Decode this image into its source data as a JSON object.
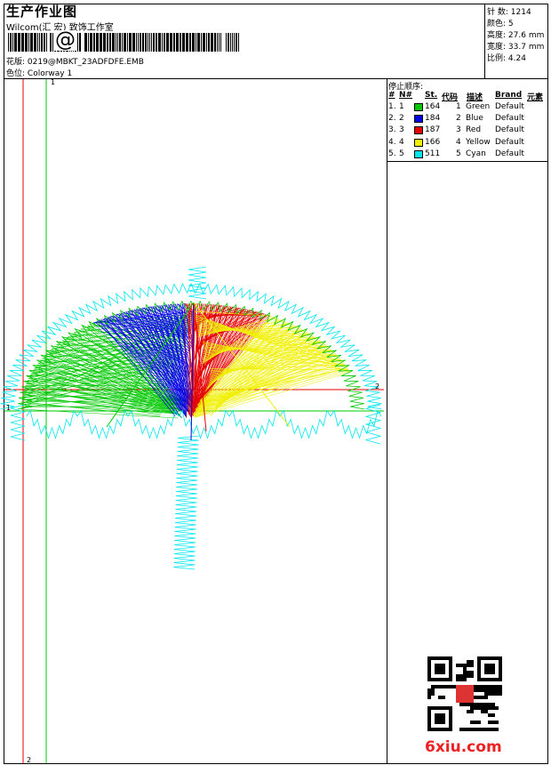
{
  "header": {
    "title": "生产作业图",
    "company": "Wilcom(汇 宏) 致饰工作室",
    "design_label": "花版:",
    "design_value": "0219@MBKT_23ADFDFE.EMB",
    "colorway_label": "色位:",
    "colorway_value": "Colorway 1"
  },
  "stats": {
    "stitches_label": "针 数:",
    "stitches": "1214",
    "colors_label": "颜色:",
    "colors": "5",
    "height_label": "高度:",
    "height": "27.6 mm",
    "width_label": "宽度:",
    "width": "33.7 mm",
    "ratio_label": "比例:",
    "ratio": "4.24"
  },
  "stop_sequence": {
    "title": "停止顺序:",
    "headers": {
      "num": "#",
      "n": "N#",
      "st": "St.",
      "code": "代码",
      "desc": "描述",
      "brand": "Brand",
      "element": "元素"
    },
    "rows": [
      {
        "num": "1.",
        "n": "1",
        "st": "164",
        "code": "1",
        "desc": "Green",
        "brand": "Default",
        "color": "#00c800"
      },
      {
        "num": "2.",
        "n": "2",
        "st": "184",
        "code": "2",
        "desc": "Blue",
        "brand": "Default",
        "color": "#0000e6"
      },
      {
        "num": "3.",
        "n": "3",
        "st": "187",
        "code": "3",
        "desc": "Red",
        "brand": "Default",
        "color": "#e60000"
      },
      {
        "num": "4.",
        "n": "4",
        "st": "166",
        "code": "4",
        "desc": "Yellow",
        "brand": "Default",
        "color": "#f0f000"
      },
      {
        "num": "5.",
        "n": "5",
        "st": "511",
        "code": "5",
        "desc": "Cyan",
        "brand": "Default",
        "color": "#00e6f0"
      }
    ]
  },
  "markers": {
    "green_top": "1",
    "green_left": "1",
    "red_right": "2",
    "red_bottom": "2"
  },
  "colors": {
    "green": "#00c800",
    "blue": "#0000e6",
    "red": "#e60000",
    "yellow": "#f0f000",
    "cyan": "#00e6f0"
  },
  "watermark": "6xiu.com"
}
